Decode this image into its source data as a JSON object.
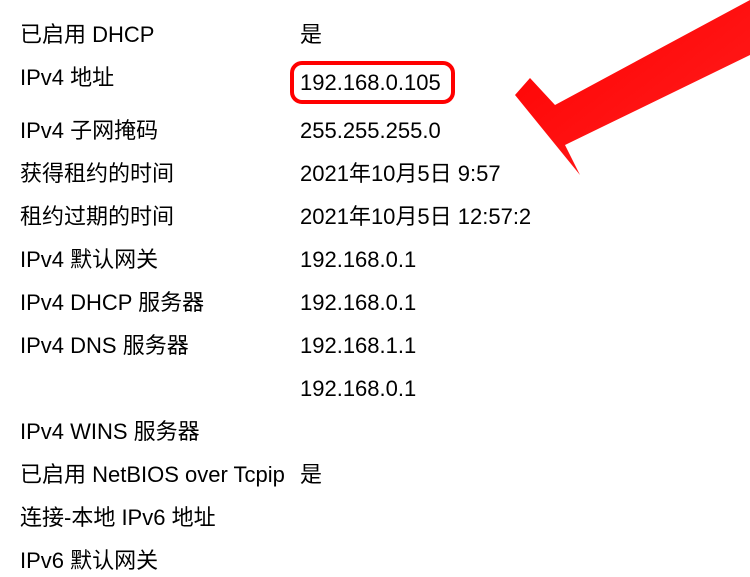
{
  "rows": [
    {
      "label": "已启用 DHCP",
      "value": "是"
    },
    {
      "label": "IPv4 地址",
      "value": "192.168.0.105",
      "highlighted": true
    },
    {
      "label": "IPv4 子网掩码",
      "value": "255.255.255.0"
    },
    {
      "label": "获得租约的时间",
      "value": "2021年10月5日 9:57"
    },
    {
      "label": "租约过期的时间",
      "value": "2021年10月5日 12:57:2"
    },
    {
      "label": "IPv4 默认网关",
      "value": "192.168.0.1"
    },
    {
      "label": "IPv4 DHCP 服务器",
      "value": "192.168.0.1"
    },
    {
      "label": "IPv4 DNS 服务器",
      "value": "192.168.1.1"
    },
    {
      "label": "",
      "value": "192.168.0.1"
    },
    {
      "label": "IPv4 WINS 服务器",
      "value": ""
    },
    {
      "label": "已启用 NetBIOS over Tcpip",
      "value": "是"
    },
    {
      "label": "连接-本地 IPv6 地址",
      "value": ""
    },
    {
      "label": "IPv6 默认网关",
      "value": ""
    }
  ]
}
